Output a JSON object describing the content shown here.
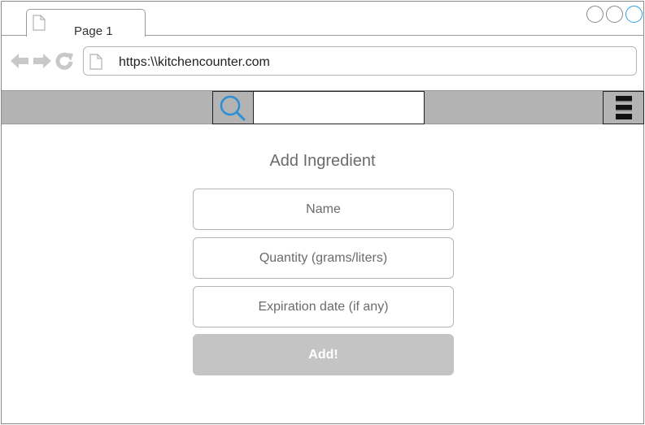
{
  "browser": {
    "tab": {
      "label": "Page 1",
      "icon": "page-icon"
    },
    "address": {
      "url": "https:\\\\kitchencounter.com",
      "icon": "page-icon"
    },
    "nav_icons": [
      "back-arrow-icon",
      "forward-arrow-icon",
      "reload-icon"
    ],
    "window_controls": [
      "minimize-circle",
      "maximize-circle",
      "close-circle"
    ],
    "accent_color": "#2aa0e6"
  },
  "toolbar": {
    "search_icon": "search-icon",
    "search_placeholder": "",
    "menu_icon": "hamburger-menu-icon",
    "background_color": "#b3b3b3"
  },
  "form": {
    "title": "Add Ingredient",
    "fields": {
      "name_placeholder": "Name",
      "quantity_placeholder": "Quantity (grams/liters)",
      "expiration_placeholder": "Expiration date (if any)"
    },
    "submit_label": "Add!",
    "submit_color": "#c4c4c4"
  }
}
